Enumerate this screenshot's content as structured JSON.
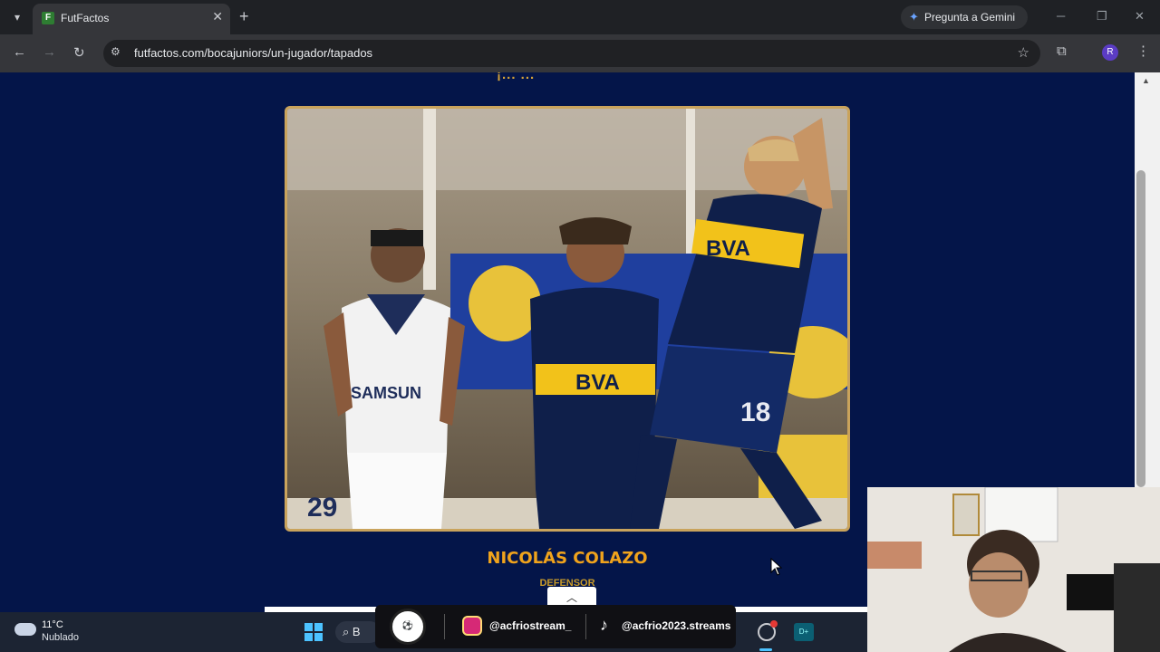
{
  "browser": {
    "tab_title": "FutFactos",
    "url": "futfactos.com/bocajuniors/un-jugador/tapados",
    "gemini_label": "Pregunta a Gemini",
    "profile_initial": "R"
  },
  "page": {
    "heading_partial": "¡... ...",
    "player": {
      "name": "NICOLÁS COLAZO",
      "position": "DEFENSOR"
    },
    "photo": {
      "shirt_text_left": "SAMSUN",
      "shirt_number_left": "29",
      "sponsor_center": "BVA",
      "sponsor_right": "BVA",
      "shirt_number_right": "18"
    }
  },
  "taskbar": {
    "temperature": "11°C",
    "weather": "Nublado",
    "search_placeholder": "B",
    "instagram_handle": "@acfriostream_",
    "tiktok_handle": "@acfrio2023.streams"
  },
  "icons": {
    "tab_search": "chevron-down-icon",
    "close": "close-icon",
    "new_tab": "plus-icon",
    "back": "back-arrow-icon",
    "forward": "forward-arrow-icon",
    "reload": "reload-icon",
    "star": "star-icon",
    "extensions": "puzzle-icon",
    "menu": "kebab-icon"
  },
  "colors": {
    "page_bg": "#041549",
    "name_gold": "#f0a31c",
    "frame_gold": "#c9a35c"
  }
}
